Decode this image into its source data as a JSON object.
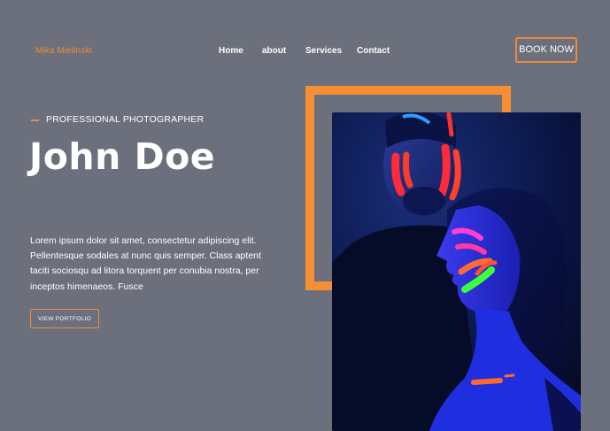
{
  "header": {
    "logo": "Mika Mielinski",
    "nav": [
      "Home",
      "about",
      "Services",
      "Contact"
    ],
    "cta": "BOOK NOW"
  },
  "hero": {
    "kicker": "PROFESSIONAL PHOTOGRAPHER",
    "title": "John Doe",
    "description": "Lorem ipsum dolor sit amet, consectetur adipiscing elit. Pellentesque sodales at nunc quis semper. Class aptent taciti sociosqu ad litora torquent per conubia nostra, per inceptos himenaeos. Fusce",
    "button": "VIEW PORTFOLIO"
  },
  "colors": {
    "background": "#6b707c",
    "accent": "#f08a3a",
    "text": "#ffffff"
  }
}
